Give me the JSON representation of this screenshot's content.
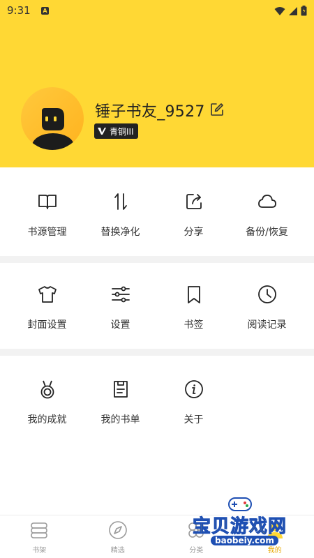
{
  "status_bar": {
    "time": "9:31",
    "app_icon_letter": "A"
  },
  "profile": {
    "username": "锤子书友_9527",
    "badge_prefix": "V",
    "badge_label": "青铜III"
  },
  "menu_rows": [
    [
      {
        "label": "书源管理",
        "icon": "book-open-icon"
      },
      {
        "label": "替换净化",
        "icon": "swap-vertical-icon"
      },
      {
        "label": "分享",
        "icon": "share-icon"
      },
      {
        "label": "备份/恢复",
        "icon": "cloud-icon"
      }
    ],
    [
      {
        "label": "封面设置",
        "icon": "tshirt-icon"
      },
      {
        "label": "设置",
        "icon": "sliders-icon"
      },
      {
        "label": "书签",
        "icon": "bookmark-icon"
      },
      {
        "label": "阅读记录",
        "icon": "clock-icon"
      }
    ],
    [
      {
        "label": "我的成就",
        "icon": "medal-icon"
      },
      {
        "label": "我的书单",
        "icon": "document-list-icon"
      },
      {
        "label": "关于",
        "icon": "info-icon"
      }
    ]
  ],
  "tabs": [
    {
      "label": "书架",
      "icon": "bookshelf-icon"
    },
    {
      "label": "精选",
      "icon": "compass-icon"
    },
    {
      "label": "分类",
      "icon": "category-icon"
    },
    {
      "label": "我的",
      "icon": "profile-icon",
      "active": true
    }
  ],
  "watermark": {
    "text": "宝贝游戏网",
    "url": "baobeiy.com"
  },
  "colors": {
    "header": "#ffd834",
    "active_tab": "#e6a800"
  }
}
